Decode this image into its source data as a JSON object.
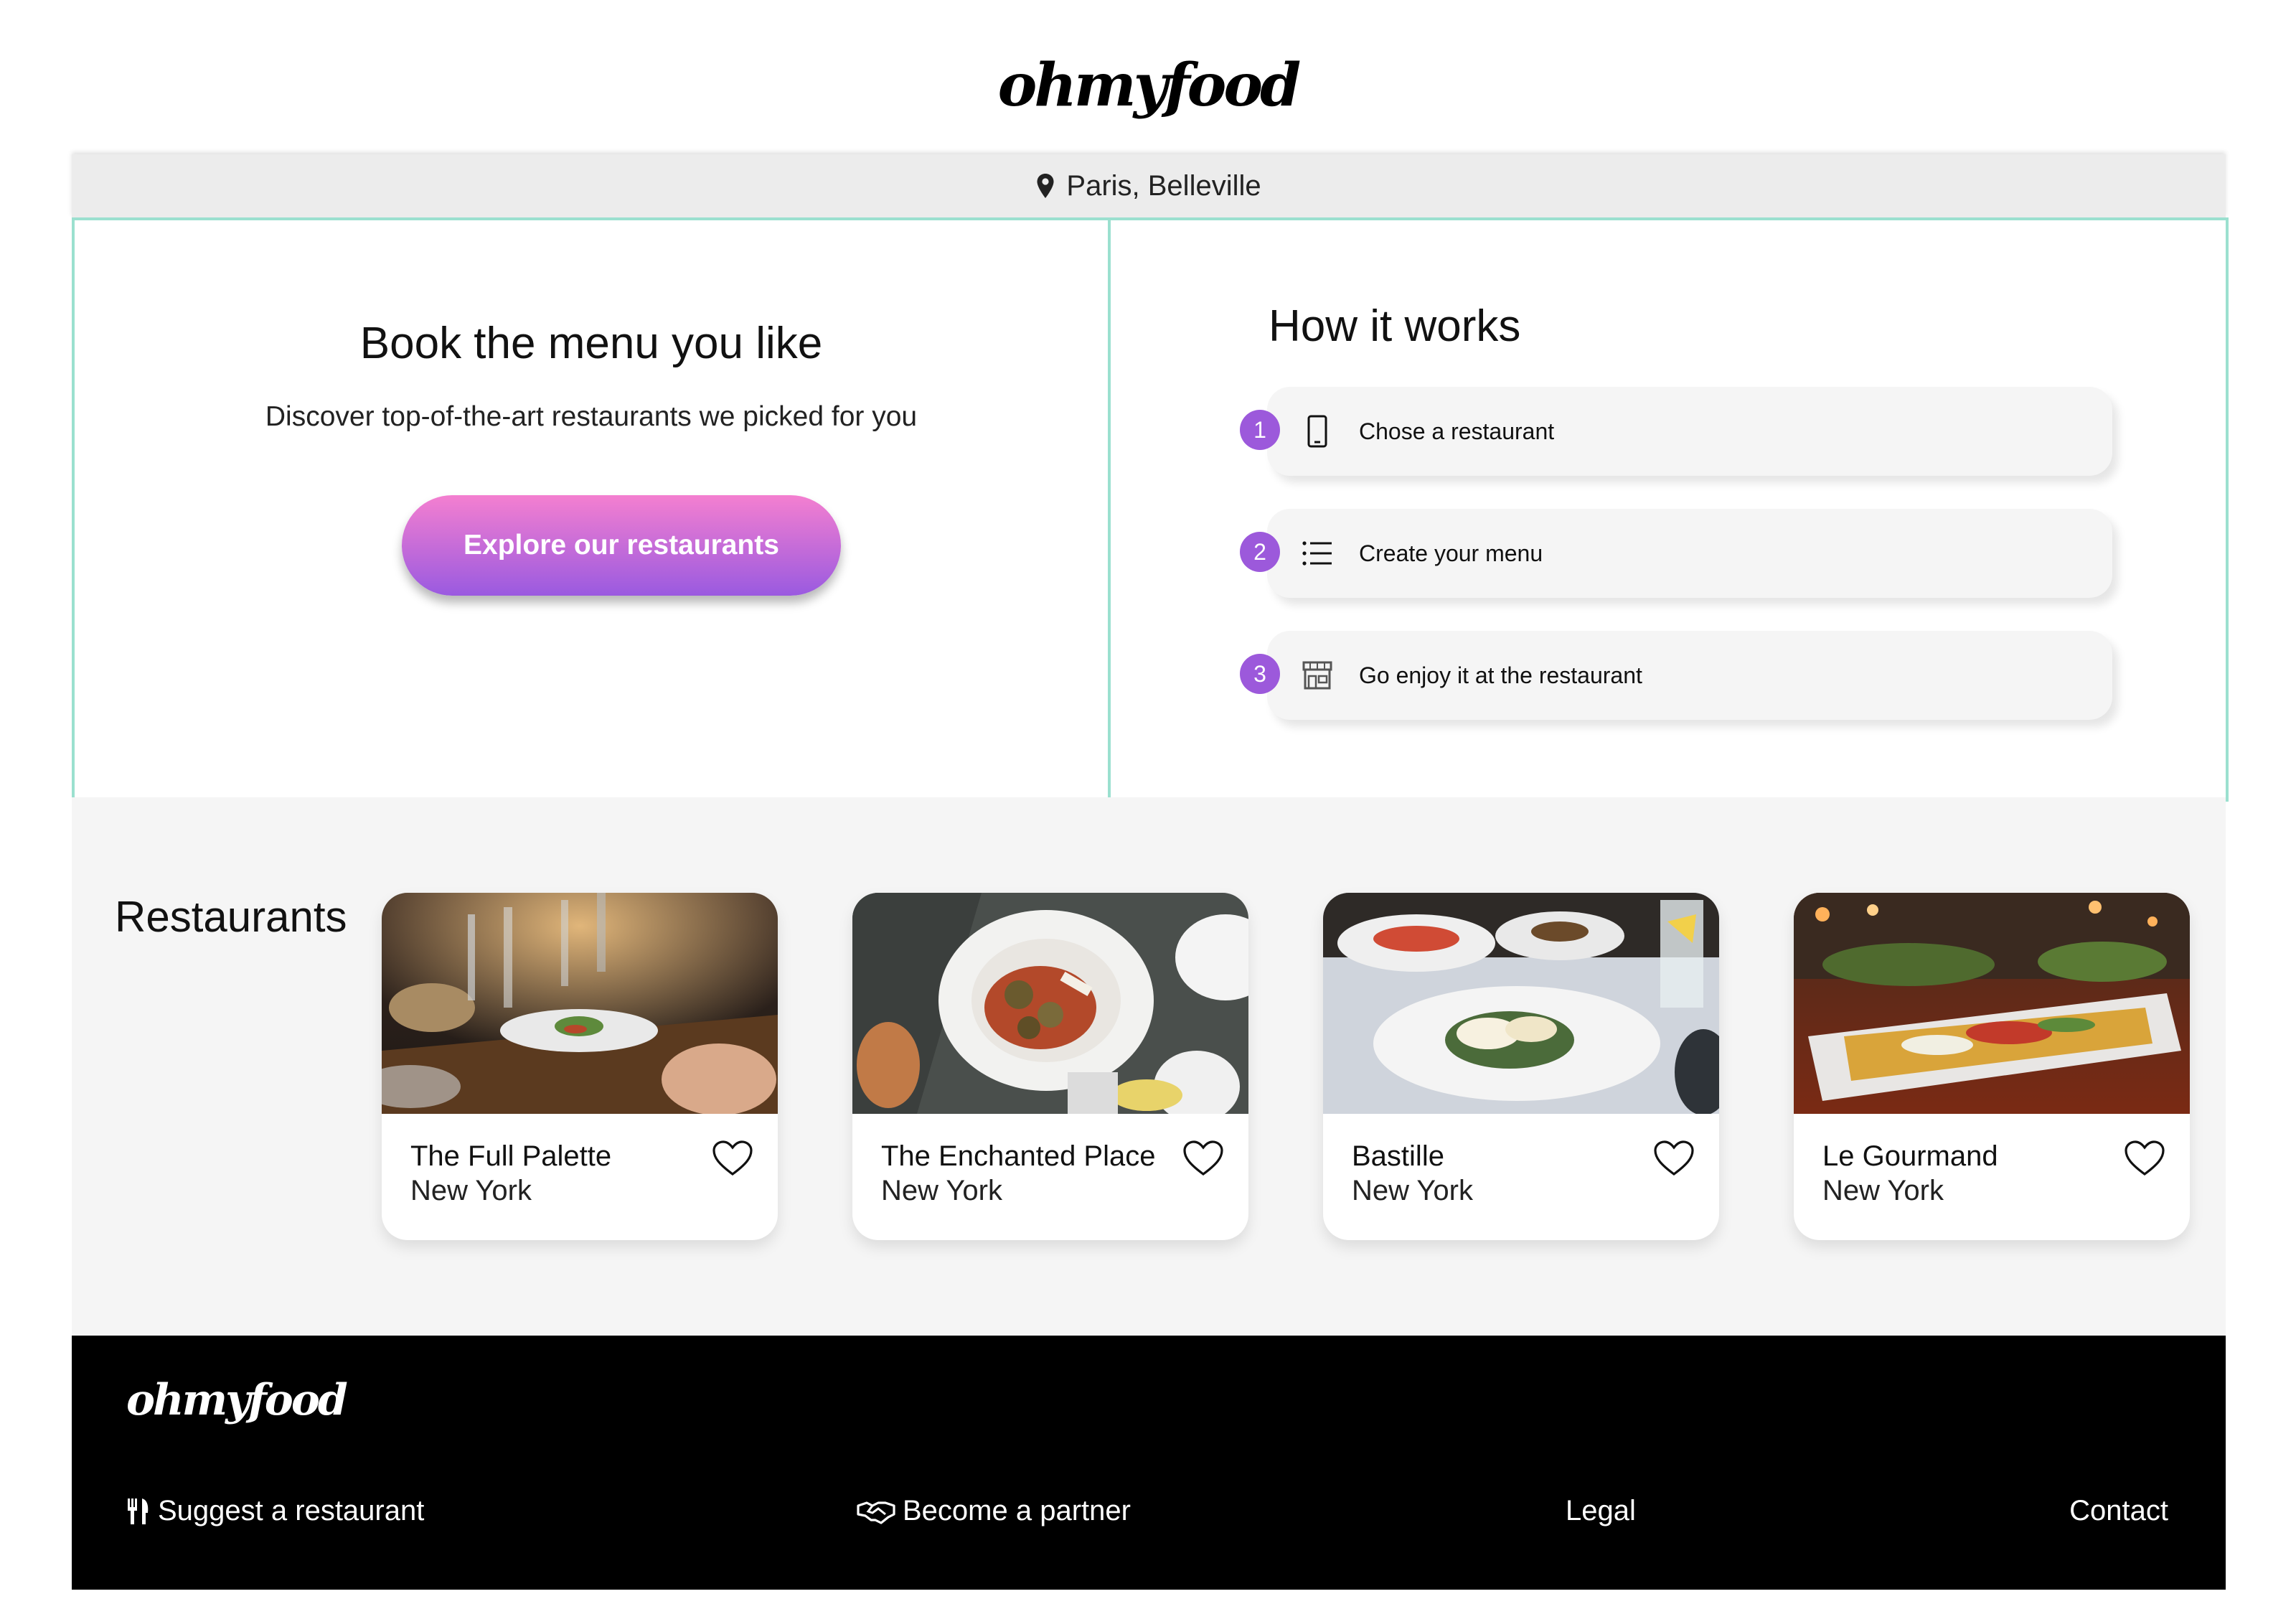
{
  "brand": {
    "logo_text": "ohmyfood"
  },
  "location": {
    "text": "Paris, Belleville",
    "icon": "map-pin-icon"
  },
  "hero": {
    "title": "Book the menu you like",
    "subtitle": "Discover top-of-the-art restaurants we picked for you",
    "cta_label": "Explore our restaurants"
  },
  "how_it_works": {
    "title": "How it works",
    "steps": [
      {
        "number": "1",
        "icon": "smartphone-icon",
        "label": "Chose a restaurant"
      },
      {
        "number": "2",
        "icon": "list-icon",
        "label": "Create your menu"
      },
      {
        "number": "3",
        "icon": "storefront-icon",
        "label": "Go enjoy it at the restaurant"
      }
    ]
  },
  "restaurants": {
    "heading": "Restaurants",
    "items": [
      {
        "name": "The Full Palette",
        "city": "New York"
      },
      {
        "name": "The Enchanted Place",
        "city": "New York"
      },
      {
        "name": "Bastille",
        "city": "New York"
      },
      {
        "name": "Le Gourmand",
        "city": "New York"
      }
    ]
  },
  "footer": {
    "logo_text": "ohmyfood",
    "links": [
      {
        "label": "Suggest a restaurant",
        "icon": "utensils-icon"
      },
      {
        "label": "Become a partner",
        "icon": "handshake-icon"
      },
      {
        "label": "Legal"
      },
      {
        "label": "Contact"
      }
    ]
  },
  "colors": {
    "accent_purple": "#9c59db",
    "gradient_pink": "#f47fd0",
    "border_mint": "#9be0cf",
    "location_bar": "#ececec",
    "section_bg": "#f5f5f5",
    "footer_bg": "#000000"
  }
}
